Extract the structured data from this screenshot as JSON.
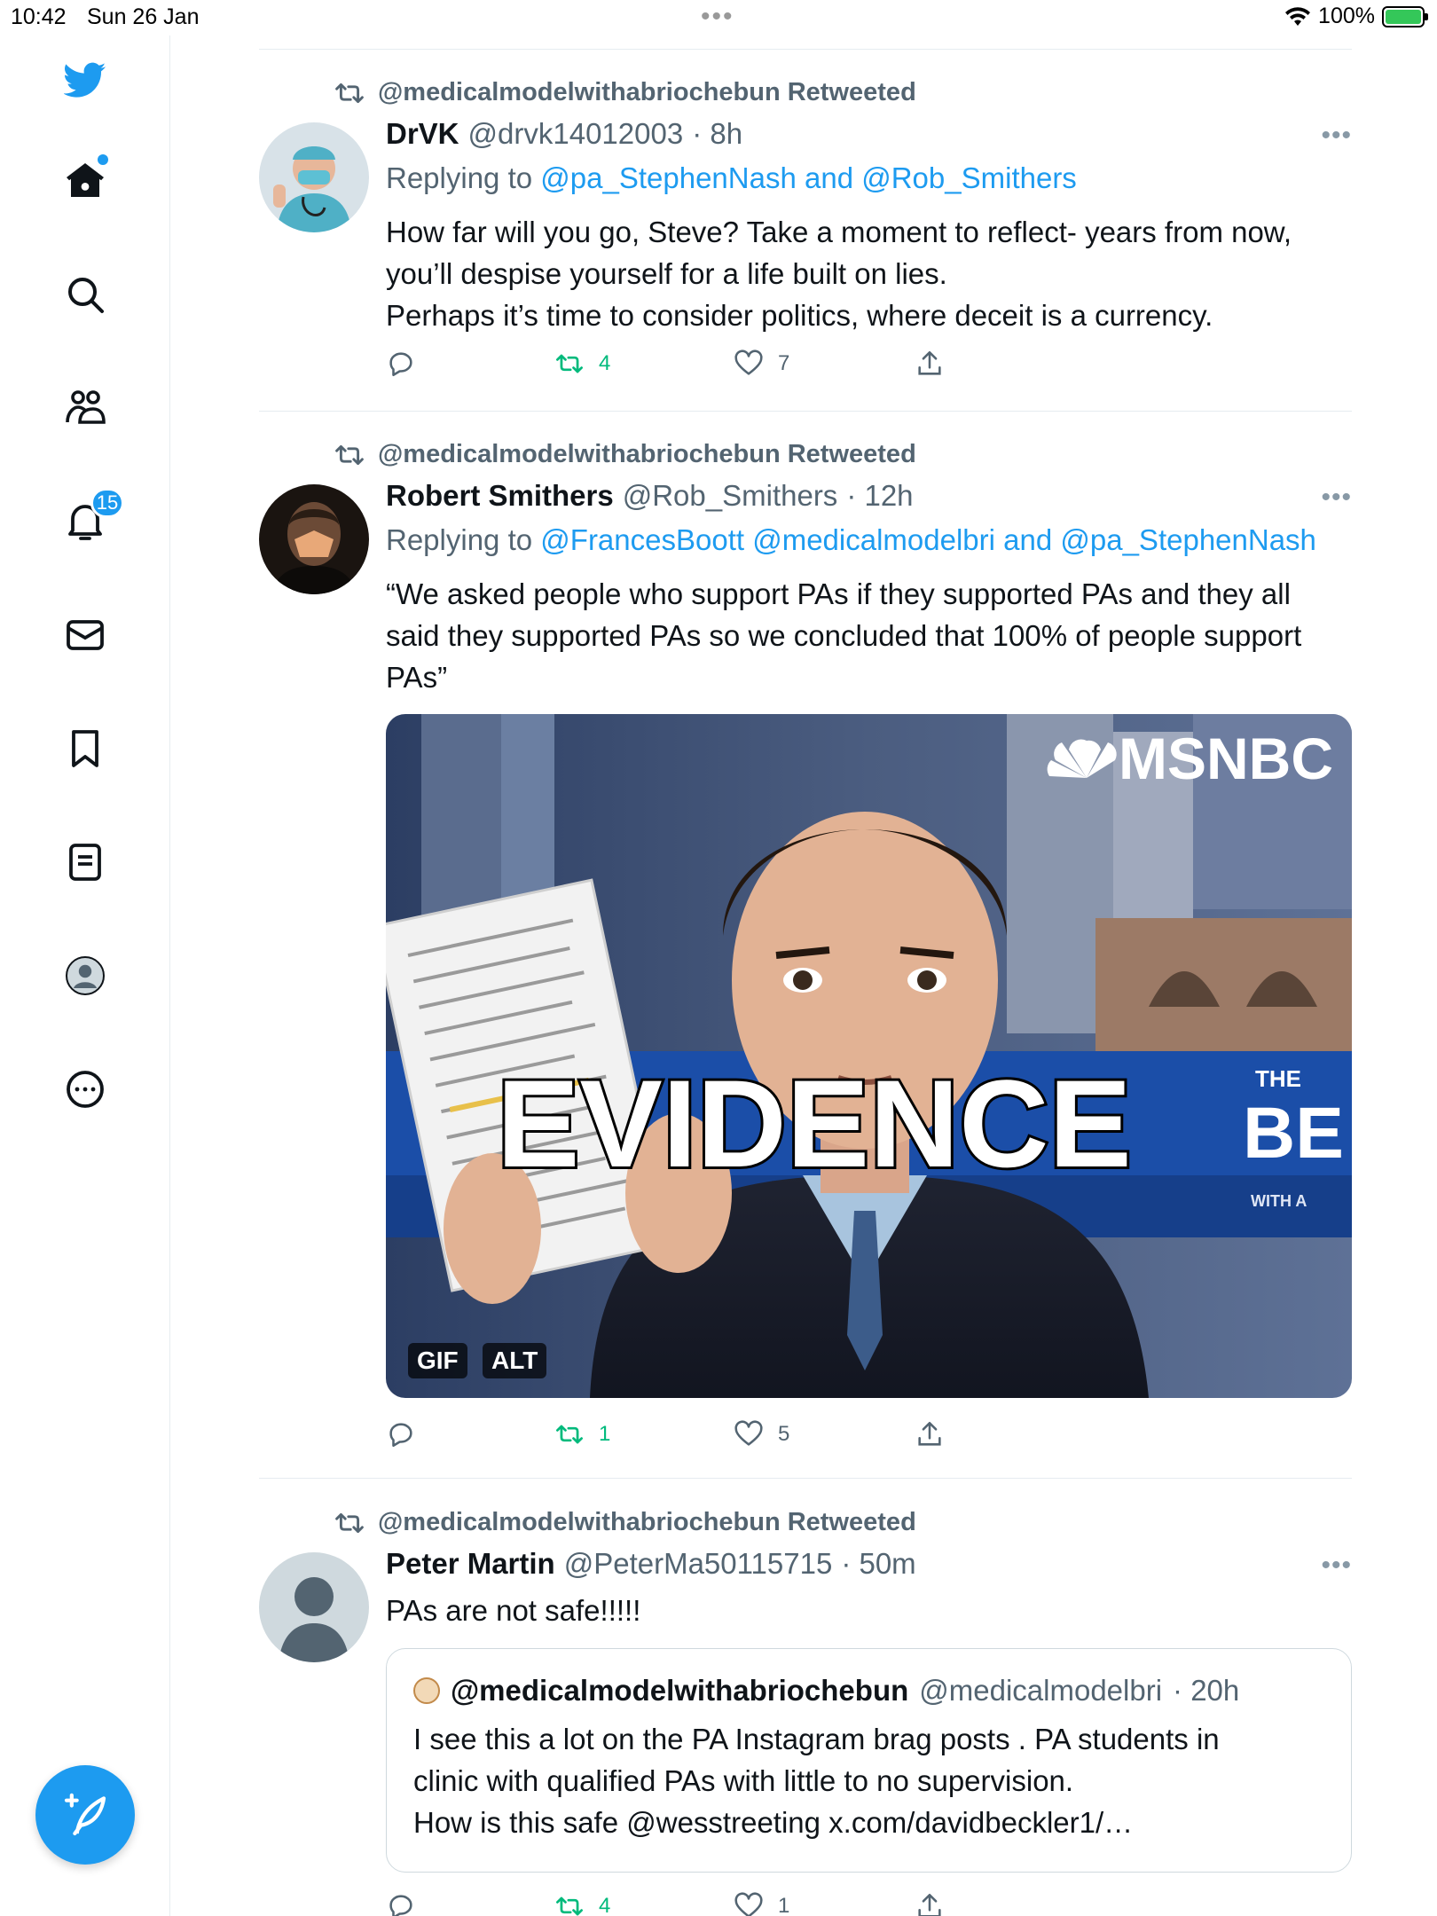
{
  "status_bar": {
    "time": "10:42",
    "date": "Sun 26 Jan",
    "battery": "100%"
  },
  "sidebar": {
    "notifications_badge": "15"
  },
  "tweets": [
    {
      "retweeted_by": "@medicalmodelwithabriochebun Retweeted",
      "name": "DrVK",
      "handle": "@drvk14012003",
      "time": "· 8h",
      "replying_prefix": "Replying to",
      "replying_links": "@pa_StephenNash and @Rob_Smithers",
      "body_lines": [
        "How far will you go, Steve? Take a moment to reflect- years from now,",
        "you’ll despise yourself for a life built on lies.",
        "Perhaps it’s time to consider politics, where deceit is a currency."
      ],
      "retweets": "4",
      "likes": "7"
    },
    {
      "retweeted_by": "@medicalmodelwithabriochebun Retweeted",
      "name": "Robert Smithers",
      "handle": "@Rob_Smithers",
      "time": "· 12h",
      "replying_prefix": "Replying to",
      "replying_links": "@FrancesBoott @medicalmodelbri and @pa_StephenNash",
      "body_lines": [
        "“We asked people who support PAs if they supported PAs and they all",
        "said they supported PAs so we concluded that 100% of people support",
        "PAs”"
      ],
      "media": {
        "network_logo": "MSNBC",
        "caption": "EVIDENCE",
        "tag_gif": "GIF",
        "tag_alt": "ALT",
        "banner_small": "THE",
        "banner_big": "BE",
        "banner_with": "WITH A",
        "banner_th": "TH"
      },
      "retweets": "1",
      "likes": "5"
    },
    {
      "retweeted_by": "@medicalmodelwithabriochebun Retweeted",
      "name": "Peter Martin",
      "handle": "@PeterMa50115715",
      "time": "· 50m",
      "body_lines": [
        "PAs are not safe!!!!!"
      ],
      "quote": {
        "name": "@medicalmodelwithabriochebun",
        "handle": "@medicalmodelbri",
        "time": "· 20h",
        "lines": [
          "I see this a lot on the PA Instagram brag posts . PA students in",
          "clinic with qualified PAs with little to no supervision.",
          "How is this safe @wesstreeting x.com/davidbeckler1/…"
        ]
      },
      "retweets": "4",
      "likes": "1"
    }
  ],
  "more_glyph": "•••",
  "colors": {
    "accent": "#1d9bf0",
    "retweet_green": "#00ba7c",
    "muted": "#536471"
  }
}
